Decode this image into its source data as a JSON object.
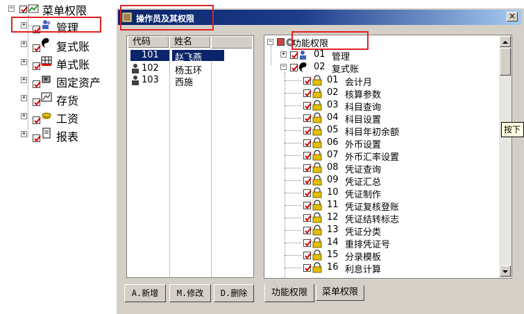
{
  "left_tree": {
    "root": "菜单权限",
    "items": [
      "管理",
      "复式账",
      "单式账",
      "固定资产",
      "存货",
      "工资",
      "报表"
    ]
  },
  "dialog": {
    "title": "操作员及其权限",
    "close_glyph": "×",
    "table": {
      "headers": [
        "代码",
        "姓名"
      ],
      "rows": [
        {
          "code": "101",
          "name": "赵飞燕"
        },
        {
          "code": "102",
          "name": "杨玉环"
        },
        {
          "code": "103",
          "name": "西施"
        }
      ]
    },
    "buttons": {
      "add": "A.新增",
      "edit": "M.修改",
      "delete": "D.删除"
    },
    "perm_tree": {
      "root": "功能权限",
      "modules": [
        {
          "code": "01",
          "name": "管理"
        },
        {
          "code": "02",
          "name": "复式账"
        }
      ],
      "functions": [
        {
          "code": "01",
          "name": "会计月"
        },
        {
          "code": "02",
          "name": "核算参数"
        },
        {
          "code": "03",
          "name": "科目查询"
        },
        {
          "code": "04",
          "name": "科目设置"
        },
        {
          "code": "05",
          "name": "科目年初余额"
        },
        {
          "code": "06",
          "name": "外币设置"
        },
        {
          "code": "07",
          "name": "外币汇率设置"
        },
        {
          "code": "08",
          "name": "凭证查询"
        },
        {
          "code": "09",
          "name": "凭证汇总"
        },
        {
          "code": "10",
          "name": "凭证制作"
        },
        {
          "code": "11",
          "name": "凭证复核登账"
        },
        {
          "code": "12",
          "name": "凭证结转标志"
        },
        {
          "code": "13",
          "name": "凭证分类"
        },
        {
          "code": "14",
          "name": "重排凭证号"
        },
        {
          "code": "15",
          "name": "分录模板"
        },
        {
          "code": "16",
          "name": "利息计算"
        }
      ]
    },
    "tabs": [
      "功能权限",
      "菜单权限"
    ]
  },
  "tooltip_fragment": "按下",
  "colors": {
    "title_bar": "#0a246a",
    "selection": "#0a246a",
    "highlight_box": "#e02020",
    "dialog_face": "#d4d0c8"
  }
}
